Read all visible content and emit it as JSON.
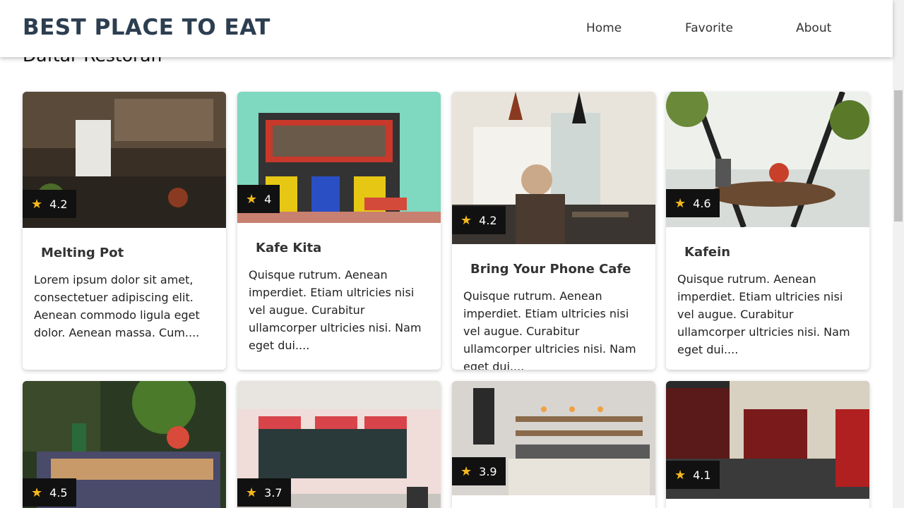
{
  "navbar": {
    "brand": "BEST PLACE TO EAT",
    "links": [
      "Home",
      "Favorite",
      "About"
    ]
  },
  "section_title": "Daftar Restoran",
  "restaurants": [
    {
      "name": "Melting Pot",
      "rating": "4.2",
      "description": "Lorem ipsum dolor sit amet, consectetuer adipiscing elit. Aenean commodo ligula eget dolor. Aenean massa. Cum...."
    },
    {
      "name": "Kafe Kita",
      "rating": "4",
      "description": "Quisque rutrum. Aenean imperdiet. Etiam ultricies nisi vel augue. Curabitur ullamcorper ultricies nisi. Nam eget dui...."
    },
    {
      "name": "Bring Your Phone Cafe",
      "rating": "4.2",
      "description": "Quisque rutrum. Aenean imperdiet. Etiam ultricies nisi vel augue. Curabitur ullamcorper ultricies nisi. Nam eget dui...."
    },
    {
      "name": "Kafein",
      "rating": "4.6",
      "description": "Quisque rutrum. Aenean imperdiet. Etiam ultricies nisi vel augue. Curabitur ullamcorper ultricies nisi. Nam eget dui...."
    },
    {
      "rating": "4.5"
    },
    {
      "rating": "3.7"
    },
    {
      "rating": "3.9"
    },
    {
      "rating": "4.1"
    }
  ],
  "colors": {
    "brand": "#2c3e50",
    "rating_bg": "#111111",
    "star": "#f5b81c"
  },
  "icons": {
    "rating": "star-icon"
  }
}
